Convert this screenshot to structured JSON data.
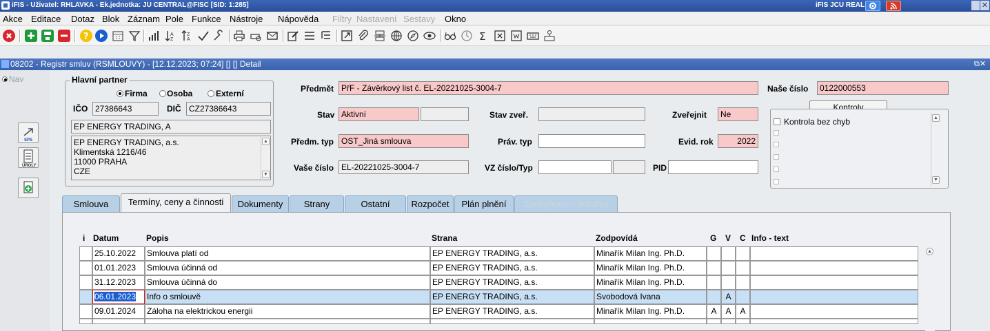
{
  "titlebar": {
    "text": "iFIS - Uživatel: RHLAVKA - Ek.jednotka: JU CENTRAL@FISC  [SID: 1:285]",
    "right_text": "iFIS JCU REAL"
  },
  "menu": {
    "items": [
      "Akce",
      "Editace",
      "Dotaz",
      "Blok",
      "Záznam",
      "Pole",
      "Funkce",
      "Nástroje",
      "Nápověda"
    ],
    "disabled_items": [
      "Filtry",
      "Nastavení",
      "Sestavy"
    ],
    "last_item": "Okno"
  },
  "document": {
    "title": "08202 - Registr smluv (RSMLOUVY) - [12.12.2023; 07:24]  [] [] Detail"
  },
  "nav": {
    "label": "Nav"
  },
  "partner": {
    "group_title": "Hlavní partner",
    "radio_firma": "Firma",
    "radio_osoba": "Osoba",
    "radio_externi": "Externí",
    "ico_label": "IČO",
    "ico_value": "27386643",
    "dic_label": "DIČ",
    "dic_value": "CZ27386643",
    "name_value": "EP ENERGY TRADING, A",
    "address_lines": [
      "EP ENERGY TRADING, a.s.",
      "Klimentská 1216/46",
      "11000 PRAHA",
      "CZE"
    ]
  },
  "form": {
    "predmet_label": "Předmět",
    "predmet_value": "PřF - Závěrkový list č. EL-20221025-3004-7",
    "nase_cislo_label": "Naše číslo",
    "nase_cislo_value": "0122000553",
    "kontroly_button": "Kontroly",
    "stav_label": "Stav",
    "stav_value": "Aktivní",
    "stav_zver_label": "Stav zveř.",
    "zverejnit_label": "Zveřejnit",
    "zverejnit_value": "Ne",
    "predm_typ_label": "Předm. typ",
    "predm_typ_value": "OST_Jiná smlouva",
    "prav_typ_label": "Práv. typ",
    "evid_rok_label": "Evid. rok",
    "evid_rok_value": "2022",
    "vase_cislo_label": "Vaše číslo",
    "vase_cislo_value": "EL-20221025-3004-7",
    "vz_cislo_label": "VZ číslo/Typ",
    "pid_label": "PID",
    "kontrola_text": "Kontrola bez chyb"
  },
  "tabs": [
    {
      "label": "Smlouva",
      "state": "normal"
    },
    {
      "label": "Termíny, ceny a činnosti",
      "state": "active"
    },
    {
      "label": "Dokumenty",
      "state": "normal"
    },
    {
      "label": "Strany",
      "state": "normal"
    },
    {
      "label": "Ostatní",
      "state": "normal"
    },
    {
      "label": "Rozpočet",
      "state": "normal"
    },
    {
      "label": "Plán plnění",
      "state": "normal"
    },
    {
      "label": "Zveřejňovací doložka",
      "state": "disabled"
    }
  ],
  "table": {
    "headers": {
      "i": "i",
      "datum": "Datum",
      "popis": "Popis",
      "strana": "Strana",
      "zodpovida": "Zodpovídá",
      "g": "G",
      "v": "V",
      "c": "C",
      "info": "Info - text"
    },
    "rows": [
      {
        "datum": "25.10.2022",
        "popis": "Smlouva platí od",
        "strana": "EP ENERGY TRADING, a.s.",
        "zodpovida": "Minařík Milan Ing. Ph.D.",
        "g": "",
        "v": "",
        "c": "",
        "info": "",
        "selected": false
      },
      {
        "datum": "01.01.2023",
        "popis": "Smlouva účinná od",
        "strana": "EP ENERGY TRADING, a.s.",
        "zodpovida": "Minařík Milan Ing. Ph.D.",
        "g": "",
        "v": "",
        "c": "",
        "info": "",
        "selected": false
      },
      {
        "datum": "31.12.2023",
        "popis": "Smlouva účinná do",
        "strana": "EP ENERGY TRADING, a.s.",
        "zodpovida": "Minařík Milan Ing. Ph.D.",
        "g": "",
        "v": "",
        "c": "",
        "info": "",
        "selected": false
      },
      {
        "datum": "06.01.2023",
        "popis": "Info o smlouvě",
        "strana": "EP ENERGY TRADING, a.s.",
        "zodpovida": "Svobodová Ivana",
        "g": "",
        "v": "A",
        "c": "",
        "info": "",
        "selected": true
      },
      {
        "datum": "09.01.2024",
        "popis": "Záloha na elektrickou energii",
        "strana": "EP ENERGY TRADING, a.s.",
        "zodpovida": "Minařík Milan Ing. Ph.D.",
        "g": "A",
        "v": "A",
        "c": "A",
        "info": "",
        "selected": false
      }
    ]
  },
  "colors": {
    "title_bar": "#2a4f99",
    "required_field": "#f9c8c8",
    "selected_row": "#c8e0f6",
    "tab": "#b8d0e6"
  }
}
